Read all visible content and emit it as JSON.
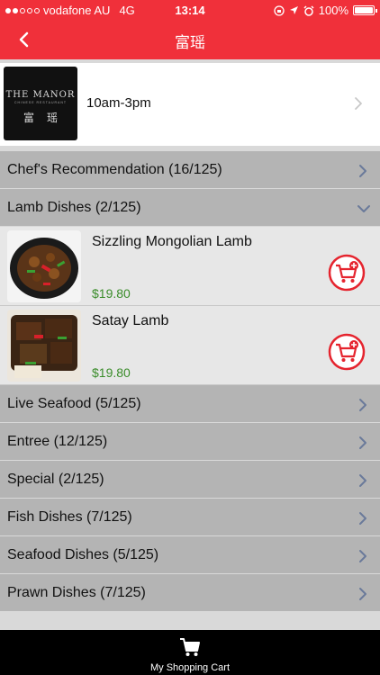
{
  "status_bar": {
    "carrier": "vodafone AU",
    "network": "4G",
    "time": "13:14",
    "battery": "100%",
    "battery_level": 1.0
  },
  "nav": {
    "title": "富瑶",
    "back_icon": "chevron-left-icon"
  },
  "restaurant": {
    "logo_text_line1": "THE MANOR",
    "logo_text_line2": "CHINESE RESTAURANT",
    "logo_text_line3": "富瑶",
    "hours": "10am-3pm"
  },
  "categories_top": [
    {
      "label": "Chef's Recommendation (16/125)"
    }
  ],
  "expanded_category": {
    "label": "Lamb Dishes (2/125)",
    "dishes": [
      {
        "name": "Sizzling Mongolian Lamb",
        "price": "$19.80"
      },
      {
        "name": "Satay Lamb",
        "price": "$19.80"
      }
    ]
  },
  "categories_bottom": [
    {
      "label": "Live Seafood (5/125)"
    },
    {
      "label": "Entree (12/125)"
    },
    {
      "label": "Special (2/125)"
    },
    {
      "label": "Fish Dishes (7/125)"
    },
    {
      "label": "Seafood Dishes (5/125)"
    },
    {
      "label": "Prawn Dishes (7/125)"
    }
  ],
  "bottom_bar": {
    "cart_label": "My Shopping Cart"
  },
  "colors": {
    "brand_red": "#f0303a",
    "price_green": "#3a8c2a",
    "category_bg": "#b4b4b4",
    "chevron_blue": "#6a7a9a"
  }
}
